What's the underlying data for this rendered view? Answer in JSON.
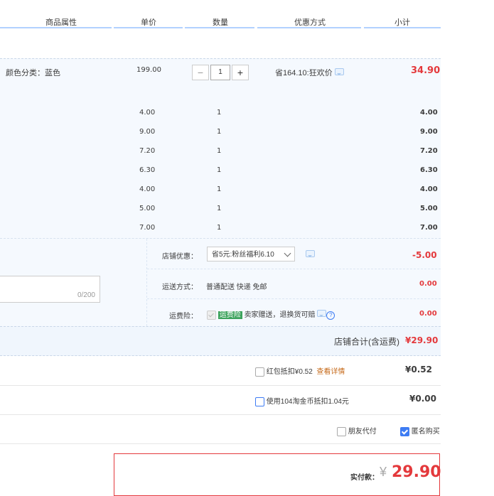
{
  "header": {
    "cols": [
      "商品属性",
      "单价",
      "数量",
      "优惠方式",
      "小计"
    ]
  },
  "item": {
    "attr": "颜色分类：蓝色",
    "price": "199.00",
    "qty": "1",
    "minus": "−",
    "plus": "+",
    "promo": "省164.10:狂欢价",
    "subtotal": "34.90"
  },
  "sub_items": [
    {
      "price": "4.00",
      "qty": "1",
      "subtotal": "4.00"
    },
    {
      "price": "9.00",
      "qty": "1",
      "subtotal": "9.00"
    },
    {
      "price": "7.20",
      "qty": "1",
      "subtotal": "7.20"
    },
    {
      "price": "6.30",
      "qty": "1",
      "subtotal": "6.30"
    },
    {
      "price": "4.00",
      "qty": "1",
      "subtotal": "4.00"
    },
    {
      "price": "5.00",
      "qty": "1",
      "subtotal": "5.00"
    },
    {
      "price": "7.00",
      "qty": "1",
      "subtotal": "7.00"
    }
  ],
  "shop": {
    "discount_label": "店铺优惠：",
    "discount_option": "省5元:粉丝福利6.10",
    "discount_value": "-5.00",
    "shipping_label": "运送方式：",
    "shipping_value": "普通配送 快递 免邮",
    "shipping_amount": "0.00",
    "insurance_label": "运费险：",
    "insurance_tag": "运费险",
    "insurance_desc": "卖家赠送，退换货可赔",
    "insurance_amount": "0.00",
    "note_counter": "0/200",
    "total_label": "店铺合计(含运费)",
    "total_value": "¥29.90"
  },
  "redpacket": {
    "label": "红包抵扣¥0.52",
    "link": "查看详情",
    "value": "¥0.52"
  },
  "coins": {
    "label": "使用104淘金币抵扣1.04元",
    "value": "¥0.00"
  },
  "options": {
    "friend_pay": "朋友代付",
    "anon": "匿名购买"
  },
  "pay": {
    "label": "实付款：",
    "currency": "¥",
    "amount": "29.90"
  },
  "colors": {
    "accent": "#f40",
    "blue": "#3e7cf3"
  }
}
